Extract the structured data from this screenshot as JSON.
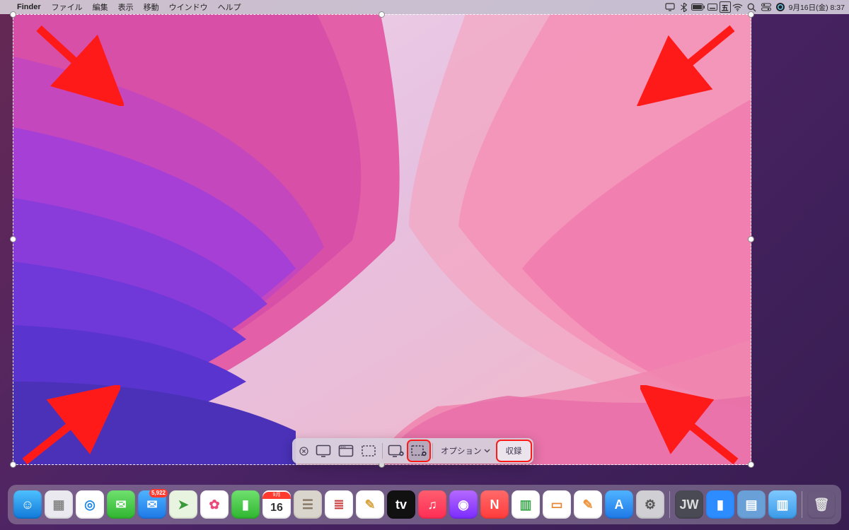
{
  "menubar": {
    "app": "Finder",
    "items": [
      "ファイル",
      "編集",
      "表示",
      "移動",
      "ウインドウ",
      "ヘルプ"
    ],
    "status_icons": [
      "screen-mirror-icon",
      "bluetooth-icon",
      "battery-icon",
      "keyboard-icon",
      "input-source-icon",
      "wifi-icon",
      "spotlight-icon",
      "control-center-icon",
      "siri-icon"
    ],
    "datetime": "9月16日(金) 8:37"
  },
  "selection": {
    "handles": [
      "tl",
      "tm",
      "tr",
      "ml",
      "mr",
      "bl",
      "bm",
      "br"
    ]
  },
  "screenshot_toolbar": {
    "close": "×",
    "buttons": [
      {
        "name": "capture-entire-screen",
        "icon": "screen"
      },
      {
        "name": "capture-window",
        "icon": "window"
      },
      {
        "name": "capture-selection",
        "icon": "selection"
      },
      {
        "name": "record-entire-screen",
        "icon": "rec-screen"
      },
      {
        "name": "record-selection",
        "icon": "rec-selection",
        "highlight": true,
        "selected": true
      }
    ],
    "options_label": "オプション",
    "capture_label": "収録",
    "capture_highlight": true
  },
  "annotations": {
    "arrows": [
      "top-left",
      "top-right",
      "bottom-left",
      "bottom-right"
    ]
  },
  "dock": {
    "items": [
      {
        "name": "finder",
        "bg": "linear-gradient(#4ec0ff,#1178d8)",
        "glyph": "☺",
        "fg": "#fff"
      },
      {
        "name": "launchpad",
        "bg": "#e9e9ef",
        "glyph": "▦",
        "fg": "#888"
      },
      {
        "name": "safari",
        "bg": "#fff",
        "glyph": "◎",
        "fg": "#1e88e5"
      },
      {
        "name": "messages",
        "bg": "linear-gradient(#6fe06f,#2fb52f)",
        "glyph": "✉",
        "fg": "#fff"
      },
      {
        "name": "mail",
        "bg": "linear-gradient(#4fb3ff,#1e78e6)",
        "glyph": "✉",
        "fg": "#fff",
        "badge": "5,922"
      },
      {
        "name": "maps",
        "bg": "#e8f3e0",
        "glyph": "➤",
        "fg": "#3a9a3a"
      },
      {
        "name": "photos",
        "bg": "#fff",
        "glyph": "✿",
        "fg": "#e94b7b"
      },
      {
        "name": "facetime",
        "bg": "linear-gradient(#6fe06f,#2fb52f)",
        "glyph": "▮",
        "fg": "#fff"
      },
      {
        "name": "calendar",
        "bg": "#fff",
        "glyph": "16",
        "fg": "#333",
        "top": "9月"
      },
      {
        "name": "contacts",
        "bg": "#d9d4cc",
        "glyph": "☰",
        "fg": "#8a7a68"
      },
      {
        "name": "reminders",
        "bg": "#fff",
        "glyph": "≣",
        "fg": "#c44"
      },
      {
        "name": "notes",
        "bg": "#fff",
        "glyph": "✎",
        "fg": "#d9a441"
      },
      {
        "name": "tv",
        "bg": "#111",
        "glyph": "tv",
        "fg": "#fff"
      },
      {
        "name": "music",
        "bg": "linear-gradient(#ff5e6f,#ff2d55)",
        "glyph": "♫",
        "fg": "#fff"
      },
      {
        "name": "podcasts",
        "bg": "linear-gradient(#b569ff,#7b2cff)",
        "glyph": "◉",
        "fg": "#fff"
      },
      {
        "name": "news",
        "bg": "linear-gradient(#ff6a6a,#ff3b3b)",
        "glyph": "N",
        "fg": "#fff"
      },
      {
        "name": "numbers",
        "bg": "#fff",
        "glyph": "▥",
        "fg": "#3fa84f"
      },
      {
        "name": "keynote",
        "bg": "#fff",
        "glyph": "▭",
        "fg": "#e6883a"
      },
      {
        "name": "pages",
        "bg": "#fff",
        "glyph": "✎",
        "fg": "#f0933a"
      },
      {
        "name": "appstore",
        "bg": "linear-gradient(#4fb3ff,#1e78e6)",
        "glyph": "A",
        "fg": "#fff"
      },
      {
        "name": "system-preferences",
        "bg": "#d0d0d4",
        "glyph": "⚙",
        "fg": "#555"
      }
    ],
    "right_items": [
      {
        "name": "jw-library",
        "bg": "#4a4a55",
        "glyph": "JW",
        "fg": "#ddd"
      },
      {
        "name": "zoom",
        "bg": "#2d8cff",
        "glyph": "▮",
        "fg": "#fff"
      },
      {
        "name": "app-generic",
        "bg": "#6aa0d8",
        "glyph": "▤",
        "fg": "#fff"
      },
      {
        "name": "folder",
        "bg": "linear-gradient(#7fc8ff,#3a9be8)",
        "glyph": "▥",
        "fg": "#fff"
      }
    ],
    "trash": {
      "name": "trash",
      "bg": "transparent",
      "glyph": "🗑",
      "fg": "#ddd"
    }
  }
}
